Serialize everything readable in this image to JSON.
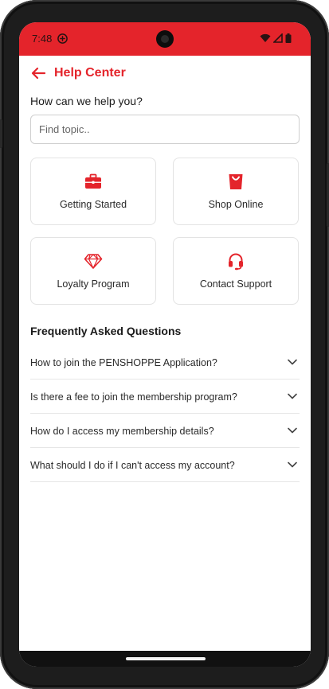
{
  "status_bar": {
    "time": "7:48",
    "app_icon": "game-controller-icon",
    "icons": [
      "wifi-icon",
      "cellular-signal-icon",
      "battery-icon"
    ]
  },
  "header": {
    "back_icon": "arrow-left-icon",
    "title": "Help Center"
  },
  "help": {
    "prompt": "How can we help you?"
  },
  "search": {
    "placeholder": "Find topic..",
    "value": ""
  },
  "categories": [
    {
      "label": "Getting Started",
      "icon": "briefcase-icon"
    },
    {
      "label": "Shop Online",
      "icon": "shopping-bag-icon"
    },
    {
      "label": "Loyalty Program",
      "icon": "diamond-icon"
    },
    {
      "label": "Contact Support",
      "icon": "headset-icon"
    }
  ],
  "faq": {
    "title": "Frequently Asked Questions",
    "items": [
      {
        "question": "How to join the PENSHOPPE Application?"
      },
      {
        "question": "Is there a fee to join the membership program?"
      },
      {
        "question": "How do I access my membership details?"
      },
      {
        "question": "What should I do if I can't access my account?"
      }
    ]
  },
  "colors": {
    "accent": "#e4242b",
    "text": "#1a1a1a",
    "border": "#e3e3e3",
    "device_frame": "#1d1d1d"
  }
}
